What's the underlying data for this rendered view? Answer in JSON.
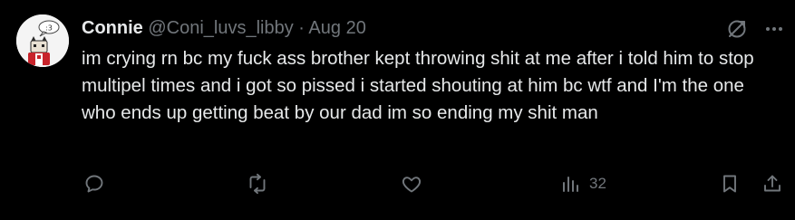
{
  "post": {
    "author_name": "Connie",
    "handle": "@Coni_luvs_libby",
    "separator": "·",
    "date": "Aug 20",
    "avatar_text": ":3",
    "text": "im crying rn bc my fuck ass brother kept throwing shit at me after i told him to stop multipel times and i got so pissed i started shouting at him bc wtf and I'm the one who ends up getting beat by our dad im so ending my shit man"
  },
  "actions": {
    "views_count": "32"
  },
  "colors": {
    "background": "#000000",
    "primary_text": "#e7e9ea",
    "secondary_text": "#71767b"
  },
  "icons": [
    "grok-icon",
    "more-icon",
    "reply-icon",
    "repost-icon",
    "like-icon",
    "views-icon",
    "bookmark-icon",
    "share-icon"
  ]
}
